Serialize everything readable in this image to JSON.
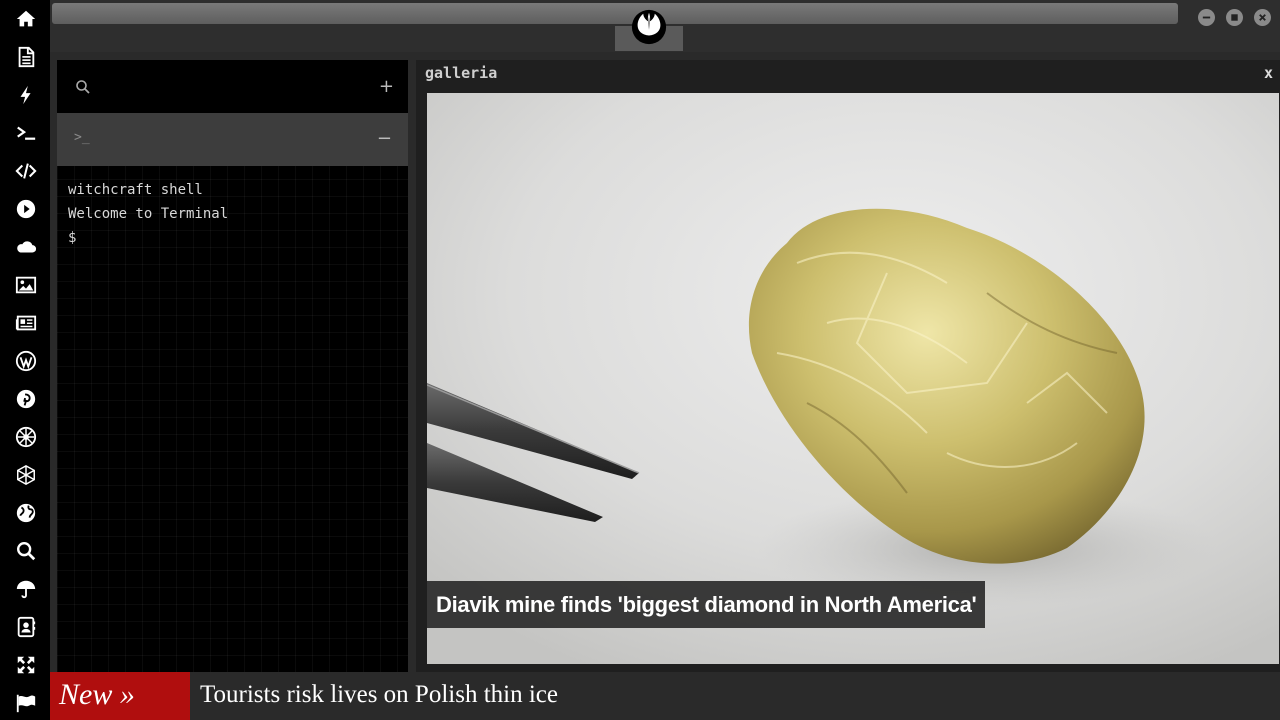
{
  "sidebar": {
    "items": [
      {
        "icon": "home-icon"
      },
      {
        "icon": "document-icon"
      },
      {
        "icon": "lightning-icon"
      },
      {
        "icon": "terminal-icon"
      },
      {
        "icon": "code-icon"
      },
      {
        "icon": "play-icon"
      },
      {
        "icon": "cloud-icon"
      },
      {
        "icon": "image-icon"
      },
      {
        "icon": "newspaper-icon"
      },
      {
        "icon": "wordpress-icon"
      },
      {
        "icon": "pinterest-icon"
      },
      {
        "icon": "galactic-republic-icon"
      },
      {
        "icon": "hexagon-network-icon"
      },
      {
        "icon": "globe-icon"
      },
      {
        "icon": "search-icon"
      },
      {
        "icon": "umbrella-icon"
      },
      {
        "icon": "contacts-icon"
      },
      {
        "icon": "expand-icon"
      },
      {
        "icon": "flag-icon"
      }
    ]
  },
  "header": {
    "logo_icon": "rebel-alliance-icon",
    "window_controls": [
      "minimize-icon",
      "maximize-icon",
      "close-icon"
    ]
  },
  "terminal": {
    "search_icon": "search-icon",
    "add_label": "+",
    "tab_prompt": ">_",
    "collapse_label": "−",
    "lines": [
      "witchcraft shell",
      "Welcome to Terminal",
      "$"
    ]
  },
  "gallery": {
    "title": "galleria",
    "close_label": "x",
    "caption": "Diavik mine finds 'biggest diamond in North America'"
  },
  "ticker": {
    "badge": "New »",
    "headline": "Tourists risk lives on Polish thin ice",
    "badge_color": "#b00e0e"
  }
}
